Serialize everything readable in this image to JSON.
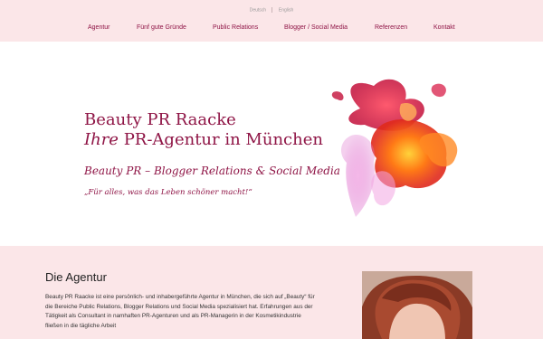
{
  "language_switcher": {
    "items": [
      "Deutsch",
      "English"
    ]
  },
  "nav": {
    "items": [
      "Agentur",
      "Fünf gute Gründe",
      "Public Relations",
      "Blogger / Social Media",
      "Referenzen",
      "Kontakt"
    ]
  },
  "hero": {
    "title_line1": "Beauty PR Raacke",
    "title_line2_em": "Ihre",
    "title_line2_rest": " PR-Agentur in München",
    "subtitle": "Beauty PR – Blogger Relations & Social Media",
    "quote": "„Für alles, was das Leben schöner macht!“"
  },
  "agentur": {
    "heading": "Die Agentur",
    "body": "Beauty PR Raacke ist eine persönlich- und inhabergeführte Agentur in München, die sich auf „Beauty“ für die Bereiche Public Relations, Blogger Relations und Social Media spezialisiert hat. Erfahrungen aus der Tätigkeit als Consultant in namhaften PR-Agenturen und als PR-Managerin in der Kosmetikindustrie fließen in die tägliche Arbeit"
  },
  "colors": {
    "brand": "#8f1546",
    "pink_bg": "#fbe6e8"
  }
}
